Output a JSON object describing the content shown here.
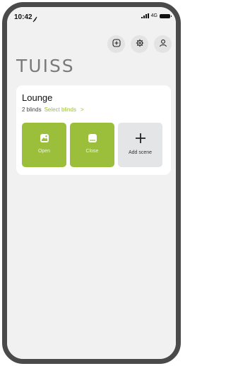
{
  "status_bar": {
    "time": "10:42",
    "network": "4G"
  },
  "header": {
    "brand": "TUISS",
    "icons": [
      "add-icon",
      "gear-icon",
      "user-icon"
    ]
  },
  "room": {
    "name": "Lounge",
    "blind_count": "2 blinds",
    "select_link": "Select blinds",
    "select_chevron": ">",
    "scenes": [
      {
        "label": "Open",
        "icon": "blind-open-icon"
      },
      {
        "label": "Close",
        "icon": "blind-close-icon"
      },
      {
        "label": "Add scene",
        "icon": "plus-icon"
      }
    ]
  },
  "colors": {
    "accent": "#9bbf3b",
    "background": "#f1f1f1",
    "card": "#ffffff",
    "brand_text": "#7a7a7a"
  }
}
